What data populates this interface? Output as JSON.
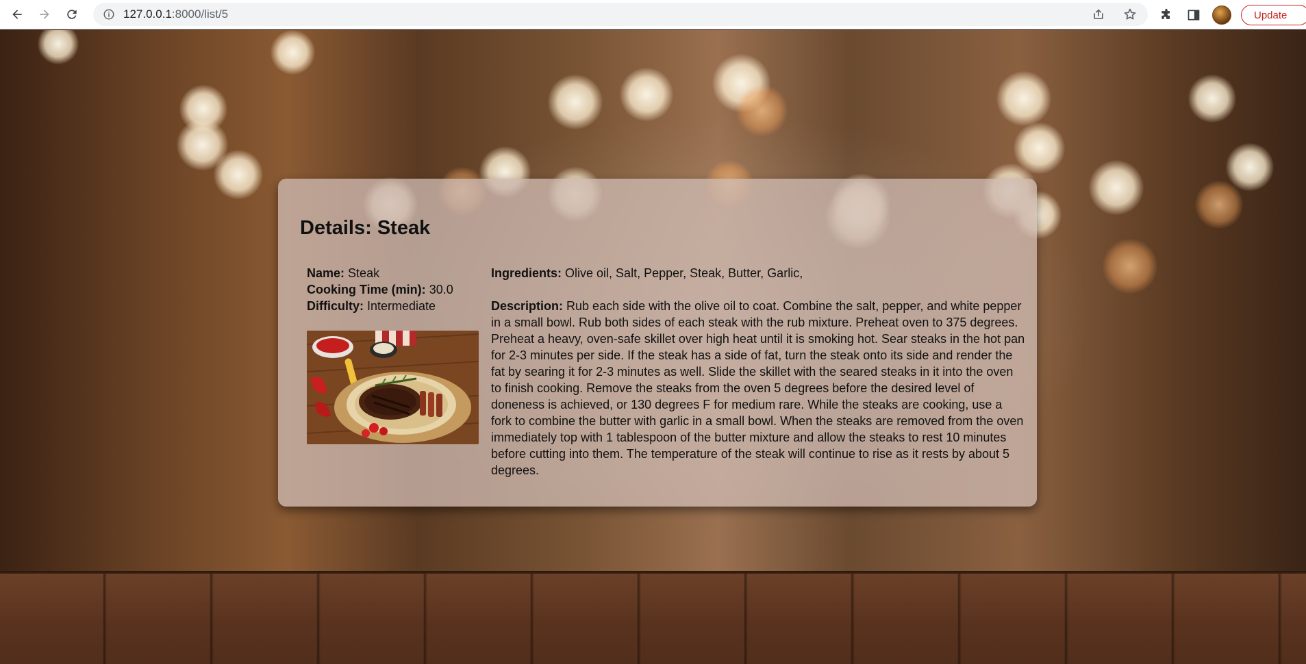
{
  "browser": {
    "url_host": "127.0.0.1",
    "url_path": ":8000/list/5",
    "update_label": "Update"
  },
  "recipe": {
    "title": "Details: Steak",
    "name_label": "Name:",
    "name_value": "Steak",
    "time_label": "Cooking Time (min):",
    "time_value": "30.0",
    "difficulty_label": "Difficulty:",
    "difficulty_value": "Intermediate",
    "ingredients_label": "Ingredients:",
    "ingredients_value": "Olive oil, Salt, Pepper, Steak, Butter, Garlic,",
    "description_label": "Description:",
    "description_value": "Rub each side with the olive oil to coat. Combine the salt, pepper, and white pepper in a small bowl. Rub both sides of each steak with the rub mixture. Preheat oven to 375 degrees. Preheat a heavy, oven-safe skillet over high heat until it is smoking hot. Sear steaks in the hot pan for 2-3 minutes per side. If the steak has a side of fat, turn the steak onto its side and render the fat by searing it for 2-3 minutes as well. Slide the skillet with the seared steaks in it into the oven to finish cooking. Remove the steaks from the oven 5 degrees before the desired level of doneness is achieved, or 130 degrees F for medium rare. While the steaks are cooking, use a fork to combine the butter with garlic in a small bowl. When the steaks are removed from the oven immediately top with 1 tablespoon of the butter mixture and allow the steaks to rest 10 minutes before cutting into them. The temperature of the steak will continue to rise as it rests by about 5 degrees."
  },
  "icons": {
    "back": "back-arrow-icon",
    "forward": "forward-arrow-icon",
    "reload": "reload-icon",
    "site_info": "info-icon",
    "share": "share-icon",
    "bookmark": "star-icon",
    "extensions": "puzzle-icon",
    "side_panel": "side-panel-icon"
  },
  "colors": {
    "update_accent": "#c5221f",
    "card_bg": "#cdb9af"
  }
}
